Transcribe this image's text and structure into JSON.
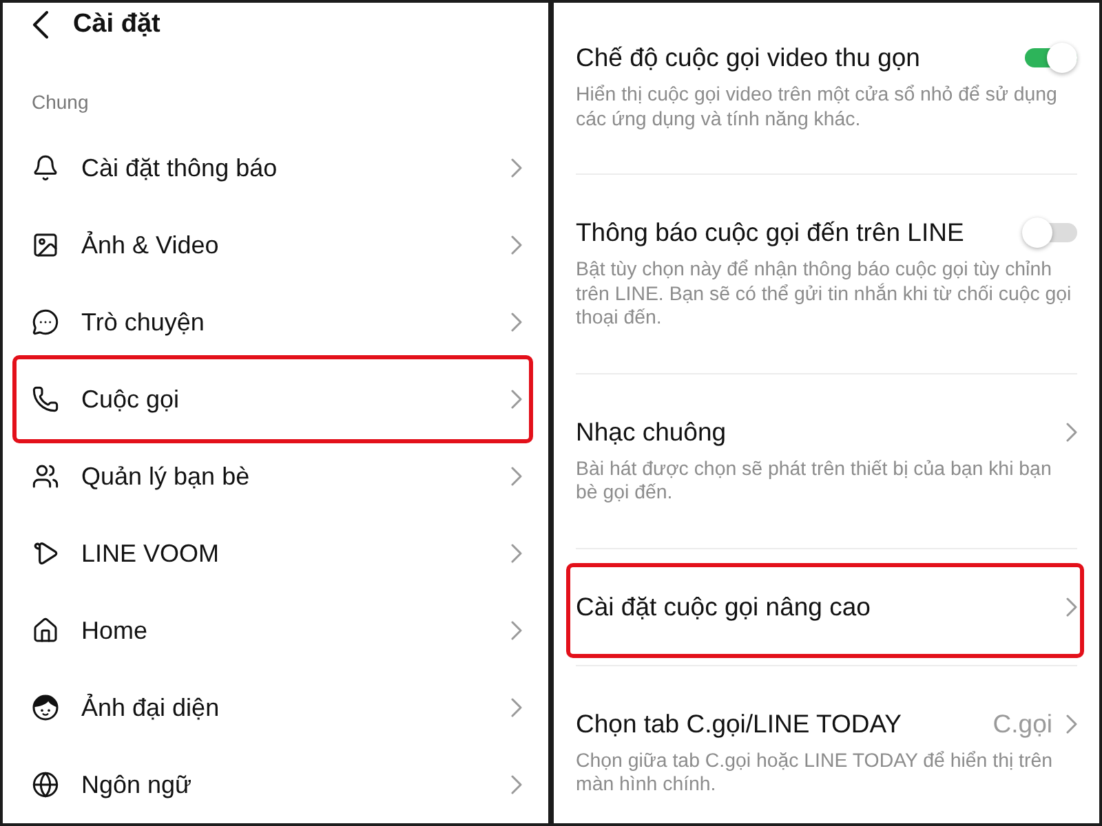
{
  "left_screen": {
    "header": {
      "title": "Cài đặt"
    },
    "section_label": "Chung",
    "items": [
      {
        "label": "Cài đặt thông báo",
        "highlighted": false
      },
      {
        "label": "Ảnh & Video",
        "highlighted": false
      },
      {
        "label": "Trò chuyện",
        "highlighted": false
      },
      {
        "label": "Cuộc gọi",
        "highlighted": true
      },
      {
        "label": "Quản lý bạn bè",
        "highlighted": false
      },
      {
        "label": "LINE VOOM",
        "highlighted": false
      },
      {
        "label": "Home",
        "highlighted": false
      },
      {
        "label": "Ảnh đại diện",
        "highlighted": false
      },
      {
        "label": "Ngôn ngữ",
        "highlighted": false
      }
    ]
  },
  "right_screen": {
    "settings": [
      {
        "kind": "toggle",
        "title": "Chế độ cuộc gọi video thu gọn",
        "on": true,
        "description": "Hiển thị cuộc gọi video trên một cửa sổ nhỏ để sử dụng các ứng dụng và tính năng khác.",
        "highlighted": false
      },
      {
        "kind": "toggle",
        "title": "Thông báo cuộc gọi đến trên LINE",
        "on": false,
        "description": "Bật tùy chọn này để nhận thông báo cuộc gọi tùy chỉnh trên LINE. Bạn sẽ có thể gửi tin nhắn khi từ chối cuộc gọi thoại đến.",
        "highlighted": false
      },
      {
        "kind": "link",
        "title": "Nhạc chuông",
        "description": "Bài hát được chọn sẽ phát trên thiết bị của bạn khi bạn bè gọi đến.",
        "highlighted": false
      },
      {
        "kind": "link",
        "title": "Cài đặt cuộc gọi nâng cao",
        "highlighted": true
      },
      {
        "kind": "value",
        "title": "Chọn tab C.gọi/LINE TODAY",
        "value": "C.gọi",
        "description": "Chọn giữa tab C.gọi hoặc LINE TODAY để hiển thị trên màn hình chính.",
        "highlighted": false
      }
    ]
  }
}
